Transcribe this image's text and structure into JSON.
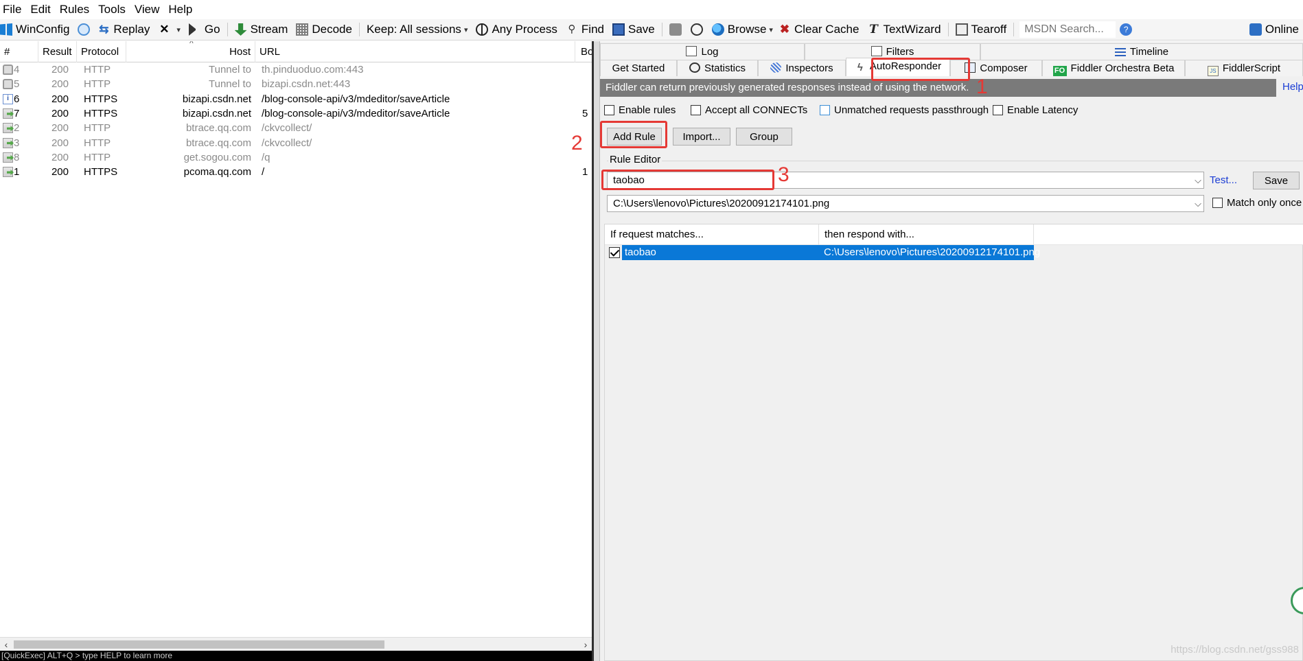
{
  "menu": [
    "File",
    "Edit",
    "Rules",
    "Tools",
    "View",
    "Help"
  ],
  "toolbar": {
    "winconfig": "WinConfig",
    "replay": "Replay",
    "go": "Go",
    "stream": "Stream",
    "decode": "Decode",
    "keep": "Keep: All sessions",
    "any_process": "Any Process",
    "find": "Find",
    "save": "Save",
    "browse": "Browse",
    "clear_cache": "Clear Cache",
    "textwizard": "TextWizard",
    "tearoff": "Tearoff",
    "msdn_search": "MSDN Search...",
    "online": "Online"
  },
  "sessions": {
    "columns": [
      "#",
      "Result",
      "Protocol",
      "Host",
      "URL",
      "Bo"
    ],
    "rows": [
      {
        "id": "4",
        "result": "200",
        "protocol": "HTTP",
        "host": "Tunnel to",
        "url": "th.pinduoduo.com:443",
        "body": "",
        "icon": "lock",
        "style": "grey"
      },
      {
        "id": "5",
        "result": "200",
        "protocol": "HTTP",
        "host": "Tunnel to",
        "url": "bizapi.csdn.net:443",
        "body": "",
        "icon": "lock",
        "style": "grey"
      },
      {
        "id": "6",
        "result": "200",
        "protocol": "HTTPS",
        "host": "bizapi.csdn.net",
        "url": "/blog-console-api/v3/mdeditor/saveArticle",
        "body": "",
        "icon": "info",
        "style": "black"
      },
      {
        "id": "7",
        "result": "200",
        "protocol": "HTTPS",
        "host": "bizapi.csdn.net",
        "url": "/blog-console-api/v3/mdeditor/saveArticle",
        "body": "5",
        "icon": "doc",
        "style": "black"
      },
      {
        "id": "2",
        "result": "200",
        "protocol": "HTTP",
        "host": "btrace.qq.com",
        "url": "/ckvcollect/",
        "body": "",
        "icon": "doc",
        "style": "grey"
      },
      {
        "id": "3",
        "result": "200",
        "protocol": "HTTP",
        "host": "btrace.qq.com",
        "url": "/ckvcollect/",
        "body": "",
        "icon": "doc",
        "style": "grey"
      },
      {
        "id": "8",
        "result": "200",
        "protocol": "HTTP",
        "host": "get.sogou.com",
        "url": "/q",
        "body": "",
        "icon": "doc",
        "style": "grey"
      },
      {
        "id": "1",
        "result": "200",
        "protocol": "HTTPS",
        "host": "pcoma.qq.com",
        "url": "/",
        "body": "1",
        "icon": "doc",
        "style": "black"
      }
    ]
  },
  "quickexec": "[QuickExec] ALT+Q > type HELP to learn more",
  "tabs_top": [
    "Log",
    "Filters",
    "Timeline"
  ],
  "tabs_main": [
    "Get Started",
    "Statistics",
    "Inspectors",
    "AutoResponder",
    "Composer",
    "Fiddler Orchestra Beta",
    "FiddlerScript"
  ],
  "autoresponder": {
    "banner": "Fiddler can return previously generated responses instead of using the network.",
    "help": "Help",
    "enable_rules": "Enable rules",
    "accept_connects": "Accept all CONNECTs",
    "unmatched": "Unmatched requests passthrough",
    "enable_latency": "Enable Latency",
    "add_rule": "Add Rule",
    "import": "Import...",
    "group": "Group",
    "rule_editor": "Rule Editor",
    "match_value": "taobao",
    "respond_value": "C:\\Users\\lenovo\\Pictures\\20200912174101.png",
    "test": "Test...",
    "save": "Save",
    "match_only_once": "Match only once",
    "col_match": "If request matches...",
    "col_respond": "then respond with...",
    "rule_match": "taobao",
    "rule_respond": "C:\\Users\\lenovo\\Pictures\\20200912174101.png"
  },
  "annotations": [
    "1",
    "2",
    "3"
  ],
  "watermark": "https://blog.csdn.net/gss988"
}
